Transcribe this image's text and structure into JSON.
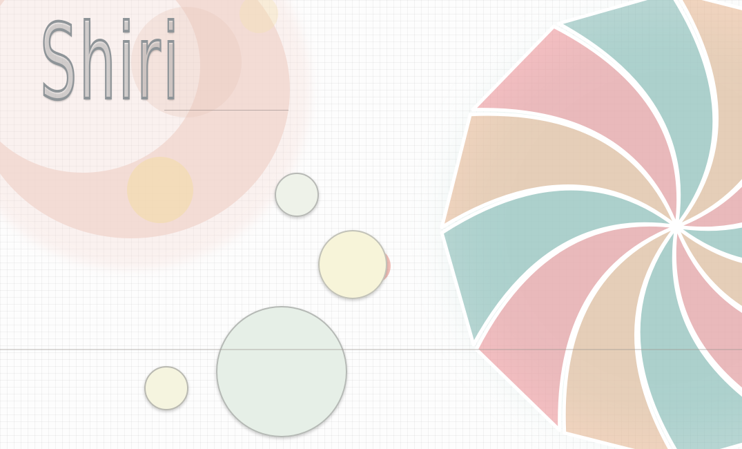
{
  "title": "Shiri",
  "colors": {
    "background": "#fdfdfd",
    "ring": "#f0d4cc",
    "pink": "#ee8c92",
    "teal": "#7fb7b1",
    "peach": "#e7b38c",
    "cream": "#f6f2d6",
    "mint": "#e5efe6"
  }
}
